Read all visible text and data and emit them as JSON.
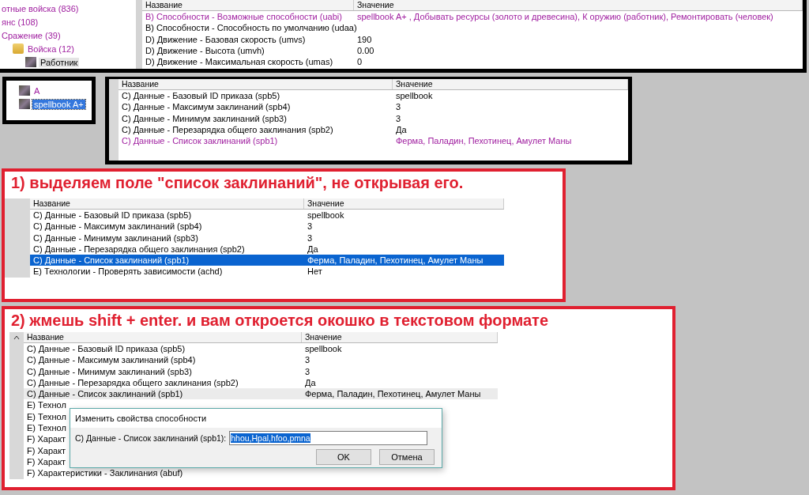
{
  "top_panel": {
    "tree": [
      {
        "label": "отные войска (836)",
        "modified": true,
        "selected": false
      },
      {
        "label": "янс (108)",
        "modified": true,
        "selected": false
      },
      {
        "label": "Сражение (39)",
        "modified": true,
        "selected": false,
        "children": [
          {
            "label": "Войска (12)",
            "kind": "folder",
            "modified": true,
            "selected": false,
            "children": [
              {
                "label": "Работник",
                "kind": "unit",
                "modified": false,
                "selected": true
              }
            ]
          }
        ]
      }
    ],
    "table": {
      "columns": [
        "Название",
        "Значение"
      ],
      "rows": [
        {
          "name": "B) Способности - Возможные способности (uabi)",
          "value": "spellbook A+ , Добывать ресурсы (золото и древесина), К оружию (работник), Ремонтировать (человек)",
          "modified": true,
          "selected": false
        },
        {
          "name": "B) Способности - Способность по умолчанию (udaa)",
          "modified": false,
          "selected": false
        },
        {
          "name": "D) Движение - Базовая скорость (umvs)",
          "value": "190",
          "modified": false,
          "selected": false
        },
        {
          "name": "D) Движение - Высота (umvh)",
          "value": "0.00",
          "modified": false,
          "selected": false
        },
        {
          "name": "D) Движение - Максимальная скорость (umas)",
          "value": "0",
          "modified": false,
          "selected": false
        }
      ]
    }
  },
  "object_panel": {
    "tree": [
      {
        "label": "A",
        "kind": "unit",
        "modified": true,
        "selected": false
      },
      {
        "label": "spellbook A+",
        "kind": "unit",
        "modified": true,
        "selected": true
      }
    ],
    "table": {
      "columns": [
        "Название",
        "Значение"
      ],
      "rows": [
        {
          "name": "C) Данные - Базовый ID приказа (spb5)",
          "value": "spellbook",
          "modified": false,
          "selected": false
        },
        {
          "name": "C) Данные - Максимум заклинаний (spb4)",
          "value": "3",
          "modified": false,
          "selected": false
        },
        {
          "name": "C) Данные - Минимум заклинаний (spb3)",
          "value": "3",
          "modified": false,
          "selected": false
        },
        {
          "name": "C) Данные - Перезарядка общего заклинания (spb2)",
          "value": "Да",
          "modified": false,
          "selected": false
        },
        {
          "name": "C) Данные - Список заклинаний (spb1)",
          "value": "Ферма, Паладин, Пехотинец, Амулет Маны",
          "modified": true,
          "selected": false
        }
      ]
    }
  },
  "steps": [
    {
      "heading": "1) выделяем поле \"список заклинаний\", не открывая его.",
      "table": {
        "columns": [
          "Название",
          "Значение"
        ],
        "rows": [
          {
            "name": "C) Данные - Базовый ID приказа (spb5)",
            "value": "spellbook",
            "modified": false,
            "selected": false
          },
          {
            "name": "C) Данные - Максимум заклинаний (spb4)",
            "value": "3",
            "modified": false,
            "selected": false
          },
          {
            "name": "C) Данные - Минимум заклинаний (spb3)",
            "value": "3",
            "modified": false,
            "selected": false
          },
          {
            "name": "C) Данные - Перезарядка общего заклинания (spb2)",
            "value": "Да",
            "modified": false,
            "selected": false
          },
          {
            "name": "C) Данные - Список заклинаний (spb1)",
            "value": "Ферма, Паладин, Пехотинец, Амулет Маны",
            "modified": false,
            "selected": true
          },
          {
            "name": "E) Технологии - Проверять зависимости (achd)",
            "value": "Нет",
            "modified": false,
            "selected": false
          }
        ]
      }
    },
    {
      "heading": "2) жмешь shift + enter. и вам откроется окошко в текстовом формате",
      "table": {
        "columns": [
          "Название",
          "Значение"
        ],
        "rows": [
          {
            "name": "C) Данные - Базовый ID приказа (spb5)",
            "value": "spellbook",
            "modified": false,
            "selected": false
          },
          {
            "name": "C) Данные - Максимум заклинаний (spb4)",
            "value": "3",
            "modified": false,
            "selected": false
          },
          {
            "name": "C) Данные - Минимум заклинаний (spb3)",
            "value": "3",
            "modified": false,
            "selected": false
          },
          {
            "name": "C) Данные - Перезарядка общего заклинания (spb2)",
            "value": "Да",
            "modified": false,
            "selected": false
          },
          {
            "name": "C) Данные - Список заклинаний (spb1)",
            "value": "Ферма, Паладин, Пехотинец, Амулет Маны",
            "modified": false,
            "selected": false,
            "hovered": true
          },
          {
            "name": "E) Технол",
            "modified": false,
            "selected": false
          },
          {
            "name": "E) Технол",
            "modified": false,
            "selected": false
          },
          {
            "name": "E) Технол",
            "modified": false,
            "selected": false
          },
          {
            "name": "F) Характ",
            "modified": false,
            "selected": false
          },
          {
            "name": "F) Характ",
            "modified": false,
            "selected": false
          },
          {
            "name": "F) Характ",
            "modified": false,
            "selected": false
          },
          {
            "name": "F) Характеристики - Заклинания (abuf)",
            "modified": false,
            "selected": false
          }
        ]
      },
      "dialog": {
        "title": "Изменить свойства способности",
        "label": "C) Данные - Список заклинаний (spb1):",
        "value": "hhou,Hpal,hfoo,pmna",
        "value_selected": true,
        "buttons": [
          "OK",
          "Отмена"
        ]
      }
    }
  ]
}
